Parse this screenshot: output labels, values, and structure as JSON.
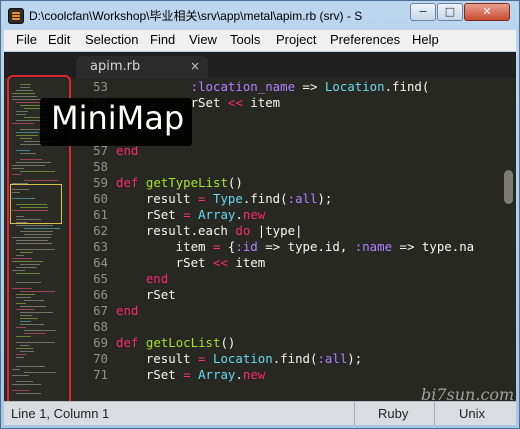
{
  "window": {
    "title": "D:\\coolcfan\\Workshop\\毕业相关\\srv\\app\\metal\\apim.rb (srv) - S",
    "min_glyph": "−",
    "max_glyph": "□",
    "close_glyph": "✕"
  },
  "menu": [
    "File",
    "Edit",
    "Selection",
    "Find",
    "View",
    "Tools",
    "Project",
    "Preferences",
    "Help"
  ],
  "tab": {
    "label": "apim.rb",
    "close_glyph": "×"
  },
  "editor": {
    "lines": [
      {
        "num": "53",
        "parts": [
          [
            "",
            "          "
          ],
          [
            "sy",
            ":location_name"
          ],
          [
            "",
            " => "
          ],
          [
            "cn",
            "Location"
          ],
          [
            "",
            ".find("
          ]
        ]
      },
      {
        "num": "54",
        "parts": [
          [
            "",
            "          rSet "
          ],
          [
            "kw",
            "<<"
          ],
          [
            "",
            " item"
          ]
        ]
      },
      {
        "num": "55",
        "parts": []
      },
      {
        "num": "56",
        "parts": []
      },
      {
        "num": "57",
        "parts": [
          [
            "kw",
            "end"
          ]
        ]
      },
      {
        "num": "58",
        "parts": []
      },
      {
        "num": "59",
        "parts": [
          [
            "kw",
            "def"
          ],
          [
            "",
            " "
          ],
          [
            "fn",
            "getTypeList"
          ],
          [
            "",
            "()"
          ]
        ]
      },
      {
        "num": "60",
        "parts": [
          [
            "",
            "    result "
          ],
          [
            "kw",
            "="
          ],
          [
            "",
            " "
          ],
          [
            "cn",
            "Type"
          ],
          [
            "",
            ".find("
          ],
          [
            "sy",
            ":all"
          ],
          [
            "",
            ");"
          ]
        ]
      },
      {
        "num": "61",
        "parts": [
          [
            "",
            "    rSet "
          ],
          [
            "kw",
            "="
          ],
          [
            "",
            " "
          ],
          [
            "cn",
            "Array"
          ],
          [
            "",
            "."
          ],
          [
            "kw",
            "new"
          ]
        ]
      },
      {
        "num": "62",
        "parts": [
          [
            "",
            "    result.each "
          ],
          [
            "kw",
            "do"
          ],
          [
            "",
            " |type|"
          ]
        ]
      },
      {
        "num": "63",
        "parts": [
          [
            "",
            "        item "
          ],
          [
            "kw",
            "="
          ],
          [
            "",
            " {"
          ],
          [
            "sy",
            ":id"
          ],
          [
            "",
            " => type.id, "
          ],
          [
            "sy",
            ":name"
          ],
          [
            "",
            " => type.na"
          ]
        ]
      },
      {
        "num": "64",
        "parts": [
          [
            "",
            "        rSet "
          ],
          [
            "kw",
            "<<"
          ],
          [
            "",
            " item"
          ]
        ]
      },
      {
        "num": "65",
        "parts": [
          [
            "",
            "    "
          ],
          [
            "kw",
            "end"
          ]
        ]
      },
      {
        "num": "66",
        "parts": [
          [
            "",
            "    rSet"
          ]
        ]
      },
      {
        "num": "67",
        "parts": [
          [
            "kw",
            "end"
          ]
        ]
      },
      {
        "num": "68",
        "parts": []
      },
      {
        "num": "69",
        "parts": [
          [
            "kw",
            "def"
          ],
          [
            "",
            " "
          ],
          [
            "fn",
            "getLocList"
          ],
          [
            "",
            "()"
          ]
        ]
      },
      {
        "num": "70",
        "parts": [
          [
            "",
            "    result "
          ],
          [
            "kw",
            "="
          ],
          [
            "",
            " "
          ],
          [
            "cn",
            "Location"
          ],
          [
            "",
            ".find("
          ],
          [
            "sy",
            ":all"
          ],
          [
            "",
            ");"
          ]
        ]
      },
      {
        "num": "71",
        "parts": [
          [
            "",
            "    rSet "
          ],
          [
            "kw",
            "="
          ],
          [
            "",
            " "
          ],
          [
            "cn",
            "Array"
          ],
          [
            "",
            "."
          ],
          [
            "kw",
            "new"
          ]
        ]
      }
    ]
  },
  "callout": {
    "label": "MiniMap"
  },
  "status": {
    "position": "Line 1, Column 1",
    "syntax": "Ruby",
    "line_endings": "Unix"
  },
  "watermark": "bi7sun.com",
  "colors": {
    "keyword": "#f92672",
    "function": "#a6e22e",
    "constant": "#66d9ef",
    "symbol": "#ae81ff",
    "background": "#272822",
    "highlight_border": "#e0262a"
  }
}
